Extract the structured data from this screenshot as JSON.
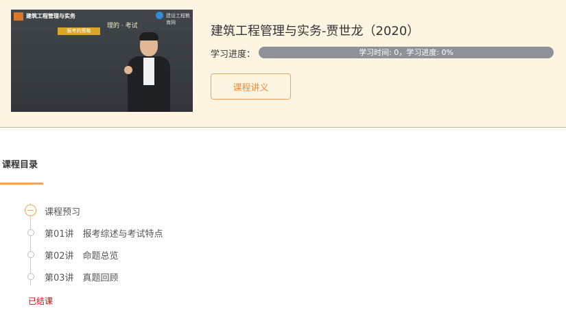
{
  "thumbnail": {
    "logo_text": "建筑工程管理与实务",
    "brand_text": "建设工程教育网",
    "board_chip": "报考的策略",
    "board_chalk": "理的 · 考试"
  },
  "course": {
    "title": "建筑工程管理与实务-贾世龙（2020）",
    "progress_label": "学习进度：",
    "progress_text": "学习时间: 0，学习进度: 0%",
    "progress_fraction": 0,
    "lecture_button": "课程讲义"
  },
  "catalog": {
    "title": "课程目录",
    "group_label": "课程预习",
    "lessons": [
      "第01讲　报考综述与考试特点",
      "第02讲　命题总览",
      "第03讲　真题回顾"
    ],
    "status": "已结课"
  },
  "colors": {
    "accent": "#f0a35a",
    "header_bg": "#fef4e2",
    "status_red": "#e60012",
    "progress_track": "#8e9196"
  }
}
